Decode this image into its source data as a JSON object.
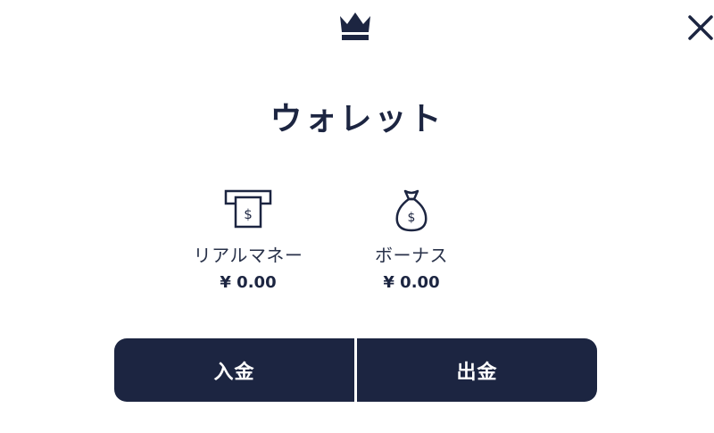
{
  "header": {
    "logo_icon": "crown-icon",
    "close_icon": "close-icon"
  },
  "title": "ウォレット",
  "balances": {
    "real_money": {
      "icon": "atm-cash-icon",
      "label": "リアルマネー",
      "amount": "¥ 0.00"
    },
    "bonus": {
      "icon": "money-bag-icon",
      "label": "ボーナス",
      "amount": "¥ 0.00"
    }
  },
  "actions": {
    "deposit_label": "入金",
    "withdraw_label": "出金"
  },
  "colors": {
    "primary": "#1c2541",
    "background": "#ffffff"
  }
}
